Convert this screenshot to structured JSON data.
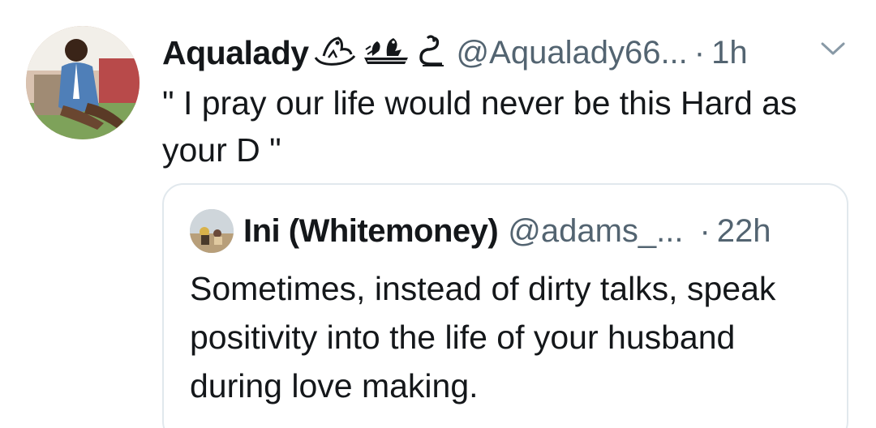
{
  "tweet": {
    "display_name": "Aqualady",
    "emoji_icons": [
      "sign-of-the-horns-icon",
      "bird-nest-icon",
      "snake-icon"
    ],
    "handle": "@Aqualady66...",
    "separator": "·",
    "time": "1h",
    "text": "\" I  pray our life would never be this Hard as your D \"",
    "more_icon": "chevron-down-icon"
  },
  "quote": {
    "display_name": "Ini (Whitemoney)",
    "handle": "@adams_...",
    "separator": "·",
    "time": "22h",
    "text": "Sometimes, instead of dirty talks, speak positivity into the life of your husband during love making."
  },
  "colors": {
    "text_primary": "#14171a",
    "text_secondary": "#536471",
    "card_border": "#e1e8ed"
  }
}
